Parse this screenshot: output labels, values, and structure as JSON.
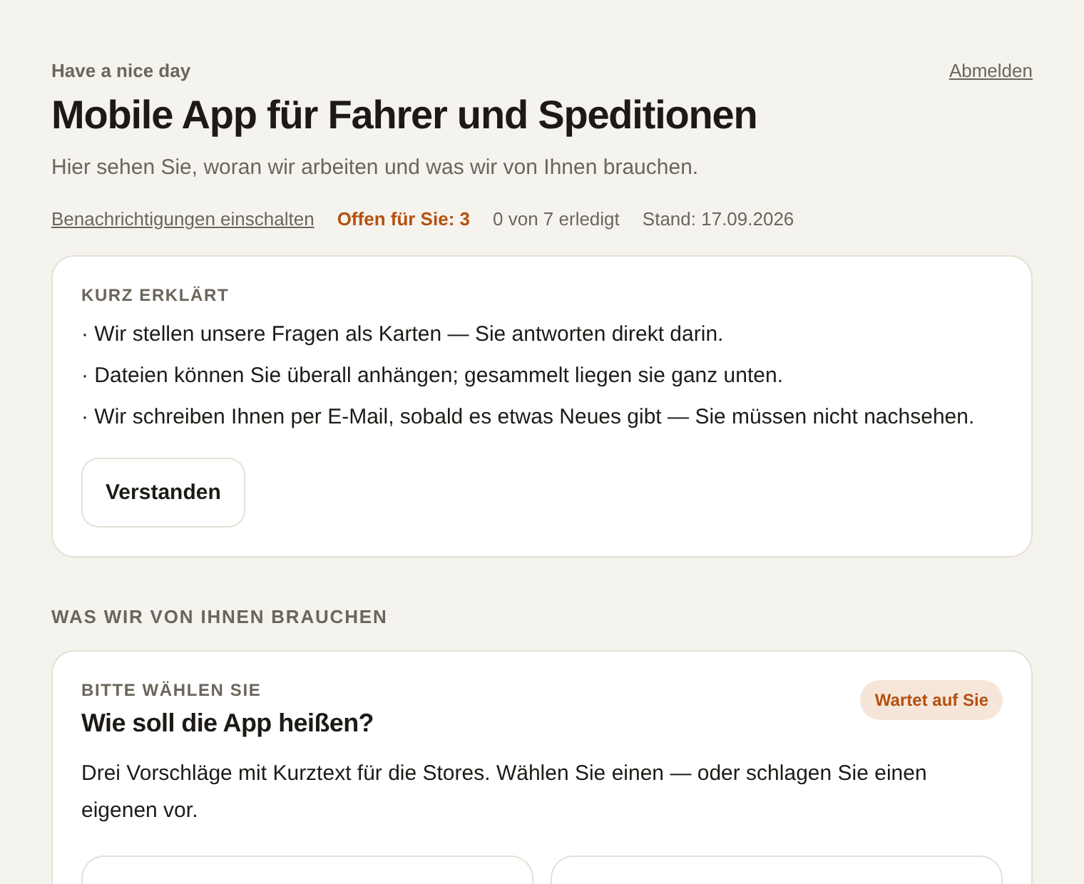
{
  "header": {
    "greeting": "Have a nice day",
    "logout": "Abmelden",
    "title": "Mobile App für Fahrer und Speditionen",
    "subtitle": "Hier sehen Sie, woran wir arbeiten und was wir von Ihnen brauchen."
  },
  "meta": {
    "notify_link": "Benachrichtigungen einschalten",
    "open": "Offen für Sie: 3",
    "progress": "0 von 7 erledigt",
    "date": "Stand: 17.09.2026"
  },
  "intro": {
    "heading": "KURZ ERKLÄRT",
    "points": [
      "· Wir stellen unsere Fragen als Karten — Sie antworten direkt darin.",
      "· Dateien können Sie überall anhängen; gesammelt liegen sie ganz unten.",
      "· Wir schreiben Ihnen per E-Mail, sobald es etwas Neues gibt — Sie müssen nicht nachsehen."
    ],
    "button": "Verstanden"
  },
  "section": {
    "heading": "WAS WIR VON IHNEN BRAUCHEN"
  },
  "task": {
    "eyebrow": "BITTE WÄHLEN SIE",
    "title": "Wie soll die App heißen?",
    "badge": "Wartet auf Sie",
    "text": "Drei Vorschläge mit Kurztext für die Stores. Wählen Sie einen — oder schlagen Sie einen eigenen vor."
  }
}
